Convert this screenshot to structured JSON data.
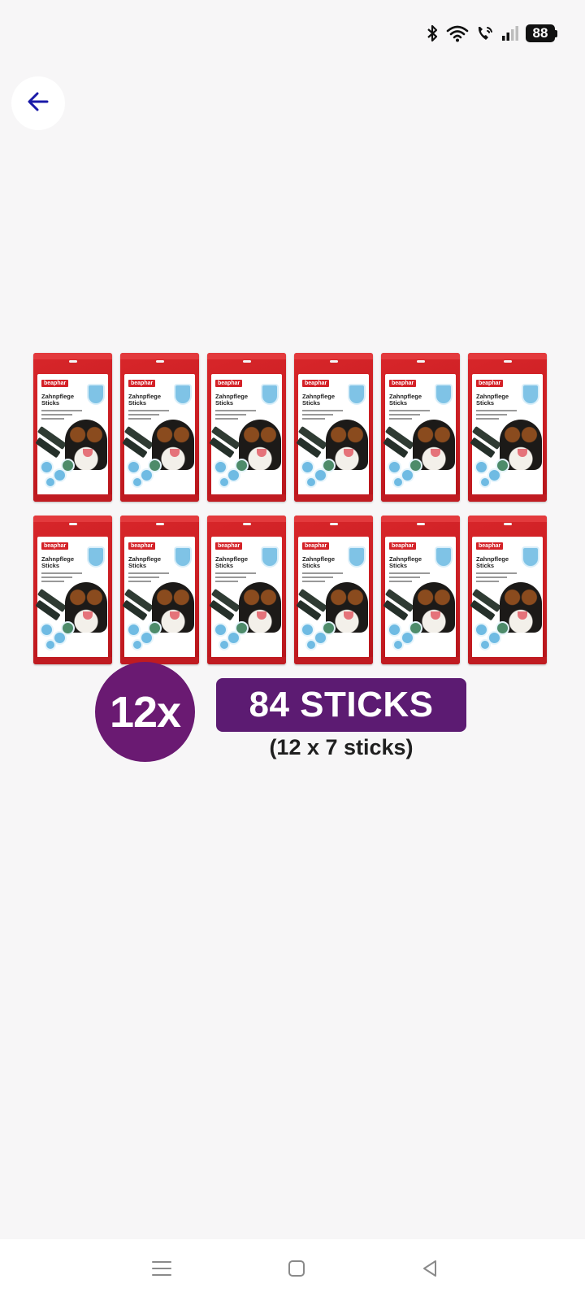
{
  "status_bar": {
    "icons": [
      "bluetooth-icon",
      "wifi-icon",
      "call-icon",
      "signal-icon"
    ],
    "battery_level": "88"
  },
  "header": {
    "back_icon": "arrow-left-icon",
    "accent_color": "#1a1aa8"
  },
  "product": {
    "pack_count": 12,
    "pack_brand": "beaphar",
    "pack_title": "Zahnpflege Sticks",
    "count_badge": "12x",
    "sticks_total": "84 STICKS",
    "sticks_detail": "(12 x 7 sticks)",
    "colors": {
      "pack_red": "#d8262a",
      "badge_purple": "#6a1a72",
      "banner_purple": "#5c1b72"
    }
  },
  "nav_bar": {
    "buttons": [
      "menu-icon",
      "home-icon",
      "back-triangle-icon"
    ]
  }
}
